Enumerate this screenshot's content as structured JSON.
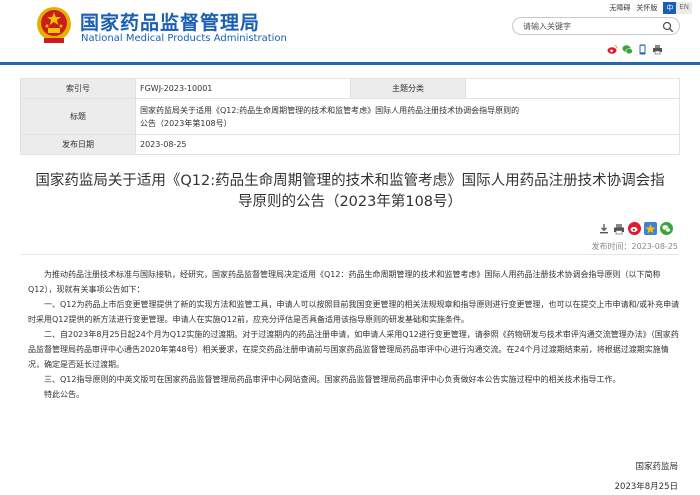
{
  "header": {
    "title_cn": "国家药品监督管理局",
    "title_en": "National Medical Products Administration",
    "links": {
      "accessibility": "无障碍",
      "care_mode": "关怀版"
    },
    "lang": {
      "zh": "中",
      "en": "EN"
    },
    "search": {
      "placeholder": "请输入关键字"
    },
    "share_icons": [
      "weibo-icon",
      "wechat-icon",
      "mobile-icon",
      "print-icon"
    ],
    "colors": {
      "brand_blue": "#1a5fb4",
      "emblem_red": "#cc1d1d",
      "emblem_gold": "#e6b000"
    }
  },
  "info": {
    "rows": [
      {
        "label": "索引号",
        "value": "FGWJ-2023-10001",
        "label2": "主题分类",
        "value2": ""
      },
      {
        "label": "标题",
        "value": "国家药监局关于适用《Q12:药品生命周期管理的技术和监管考虑》国际人用药品注册技术协调会指导原则的公告（2023年第108号）"
      },
      {
        "label": "发布日期",
        "value": "2023-08-25"
      }
    ]
  },
  "article": {
    "title": "国家药监局关于适用《Q12:药品生命周期管理的技术和监管考虑》国际人用药品注册技术协调会指导原则的公告（2023年第108号）",
    "publish_time": "发布时间：2023-08-25",
    "paragraphs": [
      "为推动药品注册技术标准与国际接轨，经研究，国家药品监督管理局决定适用《Q12：药品生命周期管理的技术和监管考虑》国际人用药品注册技术协调会指导原则（以下简称Q12），现就有关事项公告如下：",
      "一、Q12为药品上市后变更管理提供了新的实现方法和监管工具，申请人可以按照目前我国变更管理的相关法规规章和指导原则进行变更管理，也可以在提交上市申请和/或补充申请时采用Q12提供的新方法进行变更管理。申请人在实施Q12前，应充分评估是否具备适用该指导原则的研发基础和实施条件。",
      "二、自2023年8月25日起24个月为Q12实施的过渡期。对于过渡期内的药品注册申请，如申请人采用Q12进行变更管理，请参照《药物研发与技术审评沟通交流管理办法》（国家药品监督管理局药品审评中心通告2020年第48号）相关要求，在提交药品注册申请前与国家药品监督管理局药品审评中心进行沟通交流。在24个月过渡期结束前，将根据过渡期实施情况，确定是否延长过渡期。",
      "三、Q12指导原则的中英文版可在国家药品监督管理局药品审评中心网站查阅。国家药品监督管理局药品审评中心负责做好本公告实施过程中的相关技术指导工作。",
      "特此公告。"
    ],
    "signature": "国家药监局",
    "date": "2023年8月25日"
  }
}
